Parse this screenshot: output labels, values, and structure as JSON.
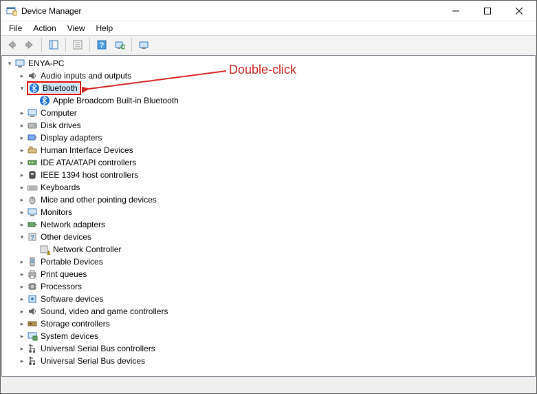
{
  "window": {
    "title": "Device Manager"
  },
  "menus": {
    "file": "File",
    "action": "Action",
    "view": "View",
    "help": "Help"
  },
  "tree": {
    "root": "ENYA-PC",
    "audio": "Audio inputs and outputs",
    "bluetooth": "Bluetooth",
    "bluetooth_child": "Apple Broadcom Built-in Bluetooth",
    "computer": "Computer",
    "disk": "Disk drives",
    "display": "Display adapters",
    "hid": "Human Interface Devices",
    "ide": "IDE ATA/ATAPI controllers",
    "ieee1394": "IEEE 1394 host controllers",
    "keyboards": "Keyboards",
    "mice": "Mice and other pointing devices",
    "monitors": "Monitors",
    "netadapters": "Network adapters",
    "other": "Other devices",
    "other_child": "Network Controller",
    "portable": "Portable Devices",
    "printq": "Print queues",
    "processors": "Processors",
    "software": "Software devices",
    "sound": "Sound, video and game controllers",
    "storage": "Storage controllers",
    "system": "System devices",
    "usb_controllers": "Universal Serial Bus controllers",
    "usb_devices": "Universal Serial Bus devices"
  },
  "annotation": {
    "text": "Double-click"
  }
}
